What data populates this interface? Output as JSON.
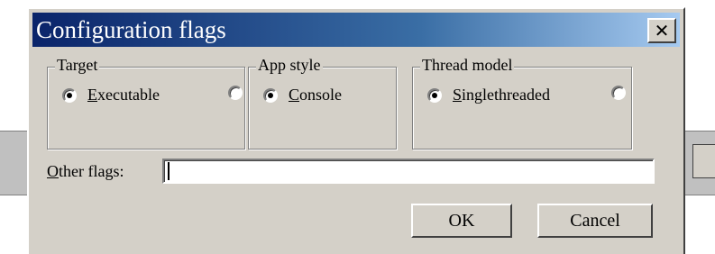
{
  "dialog": {
    "title": "Configuration flags",
    "close_symbol": "✕"
  },
  "groups": {
    "target": {
      "legend": "Target",
      "options": [
        {
          "accel": "E",
          "rest": "xecutable",
          "selected": true
        },
        {
          "accel": "",
          "rest": "",
          "selected": false
        }
      ]
    },
    "app_style": {
      "legend": "App style",
      "options": [
        {
          "accel": "C",
          "rest": "onsole",
          "selected": true
        }
      ]
    },
    "thread_model": {
      "legend": "Thread model",
      "options": [
        {
          "accel": "S",
          "rest": "inglethreaded",
          "selected": true
        },
        {
          "accel": "",
          "rest": "",
          "selected": false
        }
      ]
    }
  },
  "other_flags": {
    "label_accel": "O",
    "label_rest": "ther flags:",
    "value": ""
  },
  "buttons": {
    "ok": "OK",
    "cancel": "Cancel"
  },
  "colors": {
    "title_gradient_start": "#0a246a",
    "title_gradient_end": "#a6caf0",
    "face": "#d4d0c8"
  }
}
